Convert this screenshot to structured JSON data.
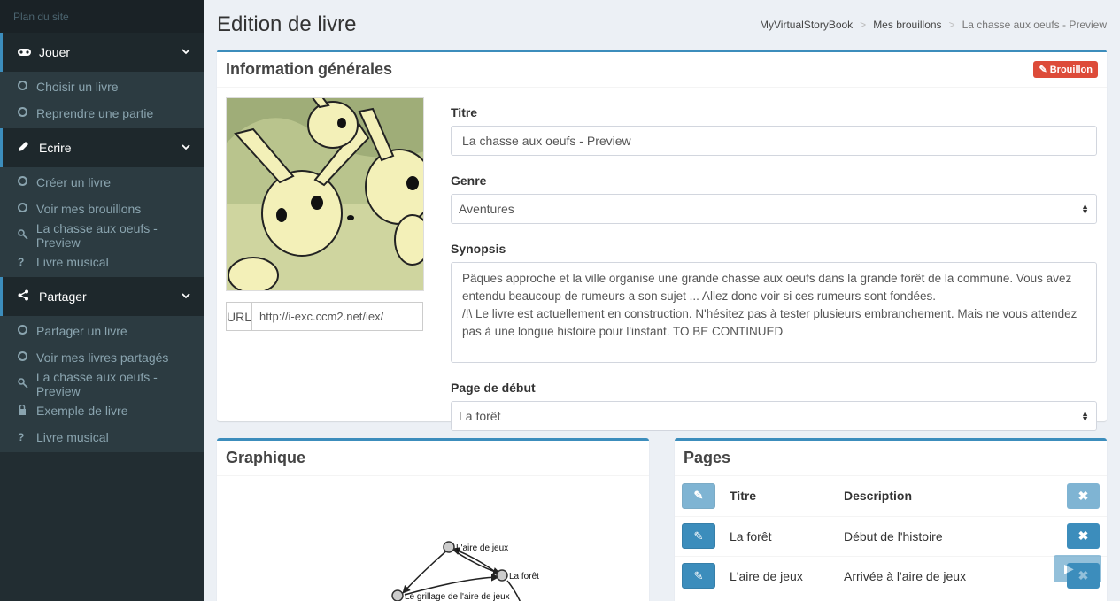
{
  "sidebar": {
    "header": "Plan du site",
    "sections": [
      {
        "label": "Jouer",
        "icon": "gamepad-icon",
        "items": [
          {
            "label": "Choisir un livre",
            "icon": "circle-icon"
          },
          {
            "label": "Reprendre une partie",
            "icon": "circle-icon"
          }
        ]
      },
      {
        "label": "Ecrire",
        "icon": "pencil-icon",
        "items": [
          {
            "label": "Créer un livre",
            "icon": "circle-icon"
          },
          {
            "label": "Voir mes brouillons",
            "icon": "circle-icon"
          },
          {
            "label": "La chasse aux oeufs - Preview",
            "icon": "key-icon"
          },
          {
            "label": "Livre musical",
            "icon": "question-icon"
          }
        ]
      },
      {
        "label": "Partager",
        "icon": "share-icon",
        "items": [
          {
            "label": "Partager un livre",
            "icon": "circle-icon"
          },
          {
            "label": "Voir mes livres partagés",
            "icon": "circle-icon"
          },
          {
            "label": "La chasse aux oeufs - Preview",
            "icon": "key-icon"
          },
          {
            "label": "Exemple de livre",
            "icon": "lock-icon"
          },
          {
            "label": "Livre musical",
            "icon": "question-icon"
          }
        ]
      }
    ]
  },
  "header": {
    "title": "Edition de livre",
    "breadcrumb": [
      "MyVirtualStoryBook",
      "Mes brouillons",
      "La chasse aux oeufs - Preview"
    ],
    "breadcrumb_sep": ">"
  },
  "info_box": {
    "title": "Information générales",
    "badge": "Brouillon",
    "url_label": "URL",
    "url_value": "http://i-exc.ccm2.net/iex/",
    "fields": {
      "titre_label": "Titre",
      "titre_value": "La chasse aux oeufs - Preview",
      "genre_label": "Genre",
      "genre_value": "Aventures",
      "synopsis_label": "Synopsis",
      "synopsis_value": "Pâques approche et la ville organise une grande chasse aux oeufs dans la grande forêt de la commune. Vous avez entendu beaucoup de rumeurs a son sujet ... Allez donc voir si ces rumeurs sont fondées.\n/!\\ Le livre est actuellement en construction. N'hésitez pas à tester plusieurs embranchement. Mais ne vous attendez pas à une longue histoire pour l'instant. TO BE CONTINUED",
      "start_label": "Page de début",
      "start_value": "La forêt"
    }
  },
  "graph_box": {
    "title": "Graphique",
    "nodes": [
      "L'aire de jeux",
      "La forêt",
      "Le grillage de l'aire de jeux"
    ]
  },
  "pages_box": {
    "title": "Pages",
    "columns": [
      "Titre",
      "Description"
    ],
    "rows": [
      {
        "titre": "La forêt",
        "description": "Début de l'histoire"
      },
      {
        "titre": "L'aire de jeux",
        "description": "Arrivée à l'aire de jeux"
      }
    ]
  },
  "colors": {
    "accent": "#3c8dbc",
    "danger": "#dd4b39",
    "sidebar_bg": "#222d32"
  }
}
